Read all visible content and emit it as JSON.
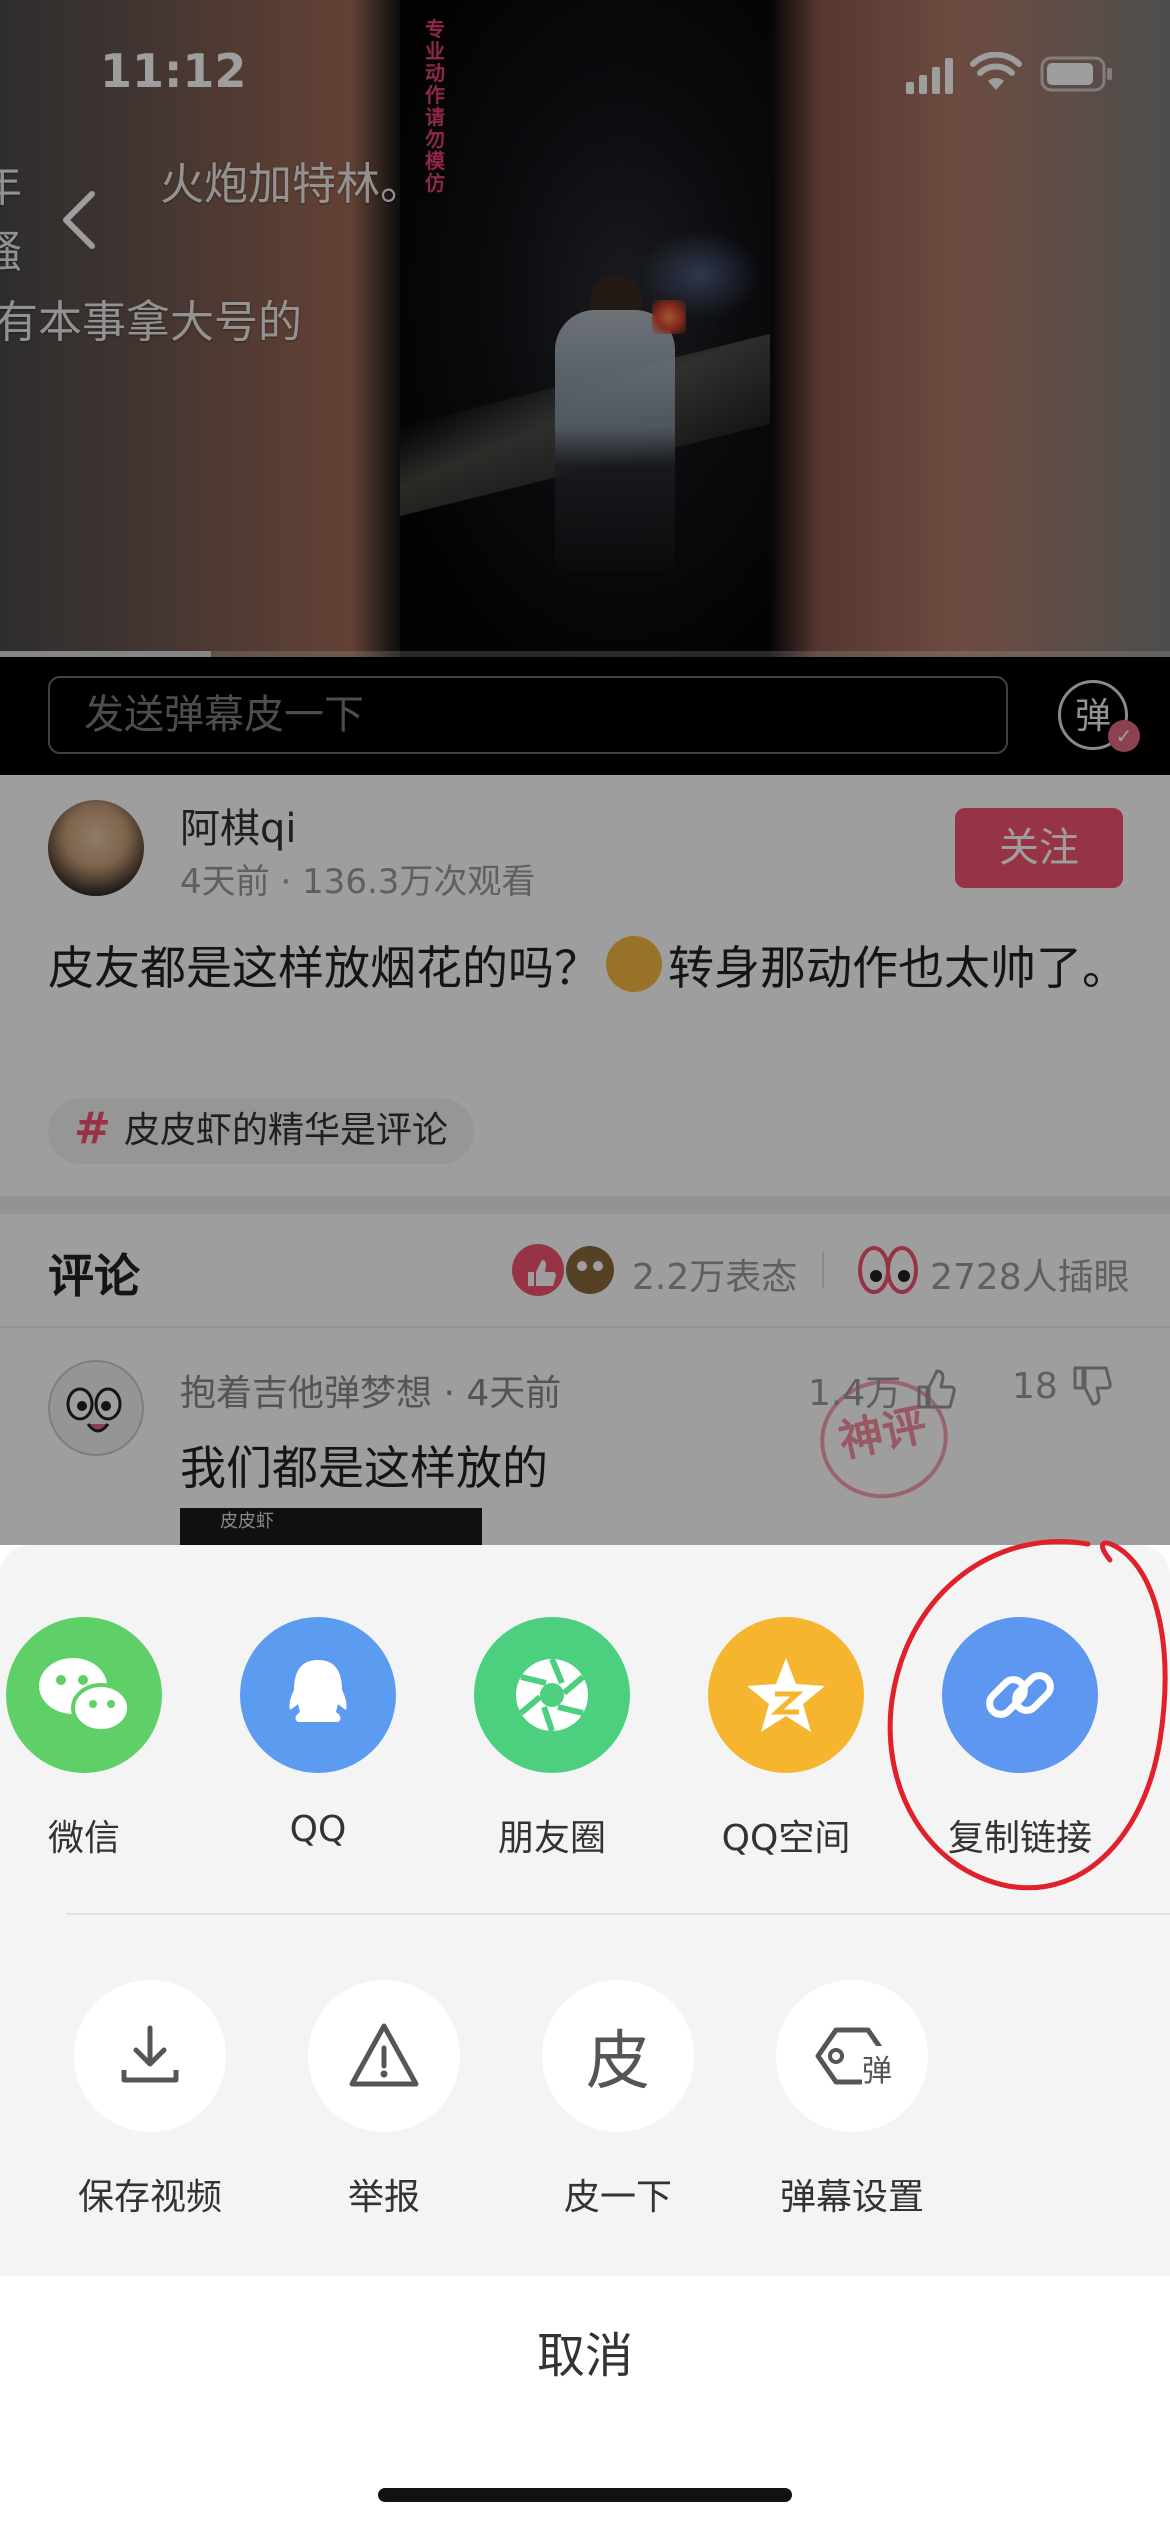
{
  "status_bar": {
    "time": "11:12"
  },
  "video": {
    "watermark": "专业动作请勿模仿",
    "danmaku": [
      "火炮加特林。",
      "有本事拿大号的",
      "年",
      "骚"
    ],
    "progress": 0.18
  },
  "danmaku_bar": {
    "placeholder": "发送弹幕皮一下",
    "toggle_label": "弹"
  },
  "post": {
    "author": "阿棋qi",
    "meta": "4天前 · 136.3万次观看",
    "follow_label": "关注",
    "text_before_emoji": "皮友都是这样放烟花的吗？",
    "text_after_emoji": "转身那动作也太帅了。",
    "topic": "皮皮虾的精华是评论"
  },
  "comments": {
    "title": "评论",
    "reactions": "2.2万表态",
    "lookers": "2728人插眼",
    "first": {
      "author_time": "抱着吉他弹梦想 · 4天前",
      "likes": "1.4万",
      "dislikes": "18",
      "text": "我们都是这样放的",
      "media_label": "皮皮虾",
      "stamp": "神评"
    }
  },
  "share_sheet": {
    "share_targets": [
      {
        "label": "微信",
        "icon": "wechat-icon",
        "color": "#5fd067"
      },
      {
        "label": "QQ",
        "icon": "qq-icon",
        "color": "#5b9cf0"
      },
      {
        "label": "朋友圈",
        "icon": "moments-icon",
        "color": "#4ccf7f"
      },
      {
        "label": "QQ空间",
        "icon": "qzone-icon",
        "color": "#f5b52e"
      },
      {
        "label": "复制链接",
        "icon": "link-icon",
        "color": "#5e97ef"
      }
    ],
    "actions": [
      {
        "label": "保存视频",
        "icon": "download-icon"
      },
      {
        "label": "举报",
        "icon": "warning-icon"
      },
      {
        "label": "皮一下",
        "icon": "pi-icon",
        "glyph": "皮"
      },
      {
        "label": "弹幕设置",
        "icon": "danmaku-settings-icon",
        "glyph": "弹"
      }
    ],
    "cancel_label": "取消"
  },
  "annotation": {
    "color": "#e0202a"
  }
}
